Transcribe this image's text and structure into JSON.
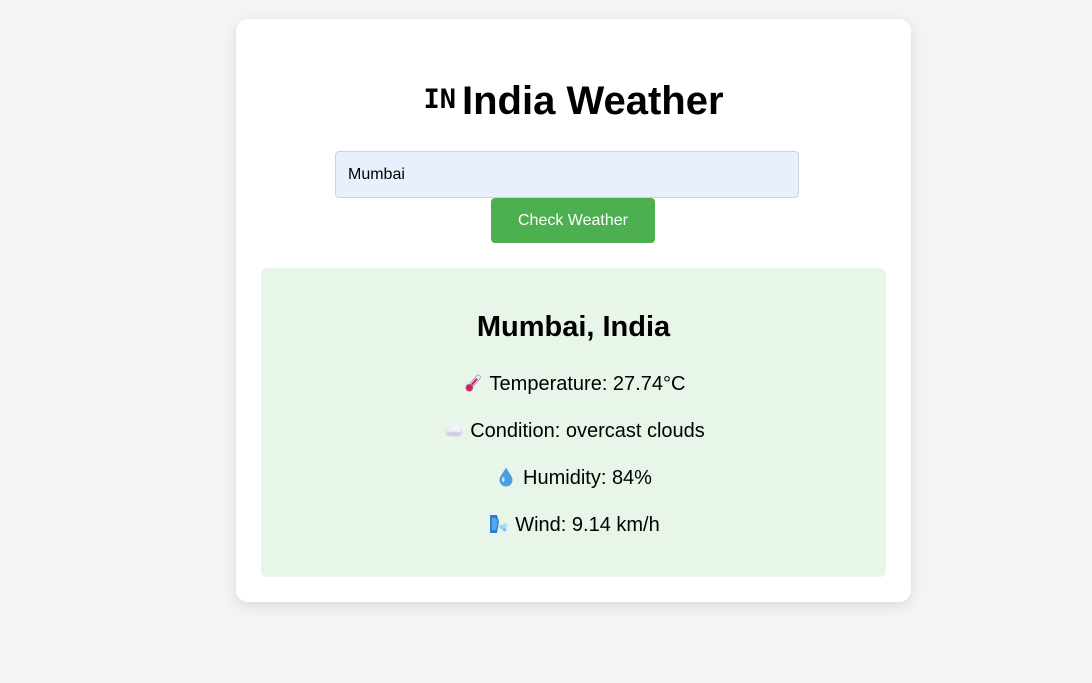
{
  "header": {
    "flag_letters": "IN",
    "title": "India Weather"
  },
  "search": {
    "value": "Mumbai",
    "placeholder": "",
    "button_label": "Check Weather"
  },
  "result": {
    "city": "Mumbai, India",
    "temperature": "Temperature: 27.74°C",
    "condition": "Condition: overcast clouds",
    "humidity": "Humidity: 84%",
    "wind": "Wind: 9.14 km/h"
  },
  "icons": {
    "temperature": "thermometer-icon",
    "condition": "cloud-icon",
    "humidity": "droplet-icon",
    "wind": "wind-face-icon"
  },
  "colors": {
    "page_background": "#f4f4f4",
    "card_background": "#ffffff",
    "input_background": "#e8f0fe",
    "button_background": "#4caf50",
    "result_background": "#e8f5e9"
  }
}
